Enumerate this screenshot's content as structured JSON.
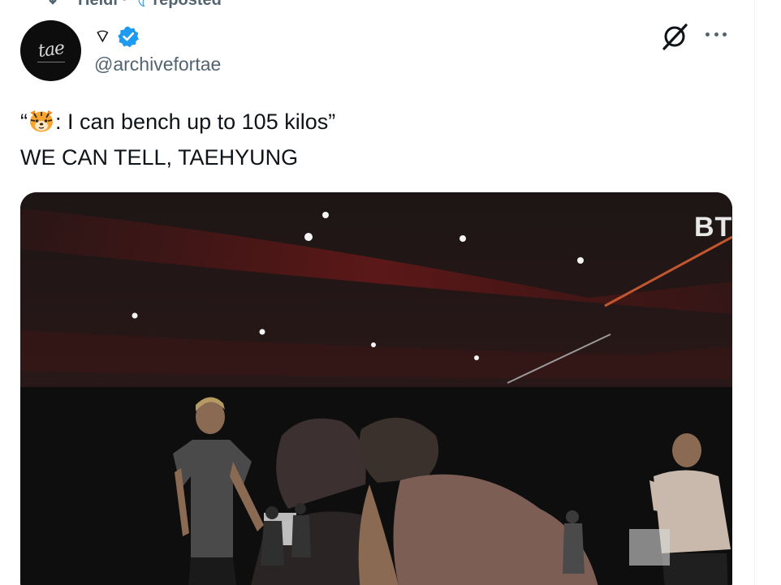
{
  "repost": {
    "user": "Heidi ·",
    "emoji": "𓆩",
    "label": "reposted",
    "icon": "repost-icon"
  },
  "author": {
    "display_name": "⌔",
    "handle": "@archivefortae",
    "avatar_text": "tae",
    "verified": true,
    "verified_color": "#1d9bf0"
  },
  "tweet": {
    "line1_open": "“",
    "line1_emoji": "tiger-face",
    "line1_rest": ": I can bench up to 105 kilos”",
    "line2": "WE CAN TELL, TAEHYUNG"
  },
  "media": {
    "watermark": "BTS"
  },
  "icons": {
    "grok": "grok-icon",
    "more": "more-icon"
  }
}
